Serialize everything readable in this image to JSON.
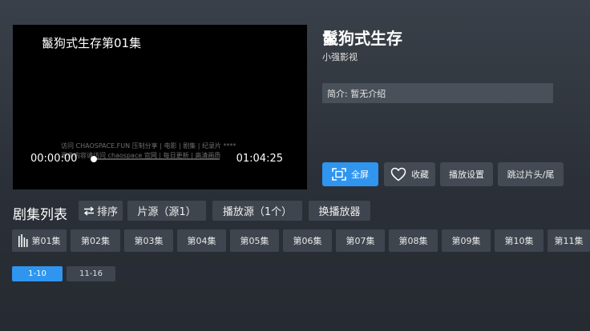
{
  "player": {
    "overlay_title": "鬣狗式生存第01集",
    "watermark_line1": "访问 CHAOSPACE.FUN 压制分享 | 电影 | 剧集 | 纪录片 ****",
    "watermark_line2": "更多内容请访问 chaospace 官网 | 每日更新 | 高清画质",
    "current_time": "00:00:00",
    "duration": "01:04:25",
    "progress": 0.0
  },
  "info": {
    "title": "鬣狗式生存",
    "subtitle": "小强影视",
    "intro": "简介: 暂无介绍"
  },
  "actions": {
    "fullscreen": "全屏",
    "favorite": "收藏",
    "play_settings": "播放设置",
    "skip": "跳过片头/尾"
  },
  "episode_list": {
    "title": "剧集列表",
    "sort": "排序",
    "source": "片源（源1）",
    "play_source": "播放源（1个）",
    "switch_player": "换播放器",
    "episodes": [
      "第01集",
      "第02集",
      "第03集",
      "第04集",
      "第05集",
      "第06集",
      "第07集",
      "第08集",
      "第09集",
      "第10集",
      "第11集"
    ],
    "ranges": [
      "1-10",
      "11-16"
    ]
  },
  "colors": {
    "accent": "#2f95ef",
    "panel": "#3f454e"
  }
}
